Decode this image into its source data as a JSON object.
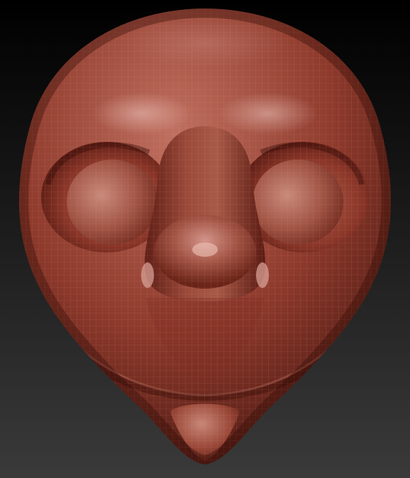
{
  "scene": {
    "subject": "sculpted-head",
    "colors": {
      "background_top": "#000000",
      "background_bottom": "#3a3a3a",
      "clay_base": "#8e3a2c",
      "clay_light": "#c07060",
      "clay_dark": "#4a1812",
      "specular": "#f0c8c0",
      "wire": "#d08070"
    }
  }
}
